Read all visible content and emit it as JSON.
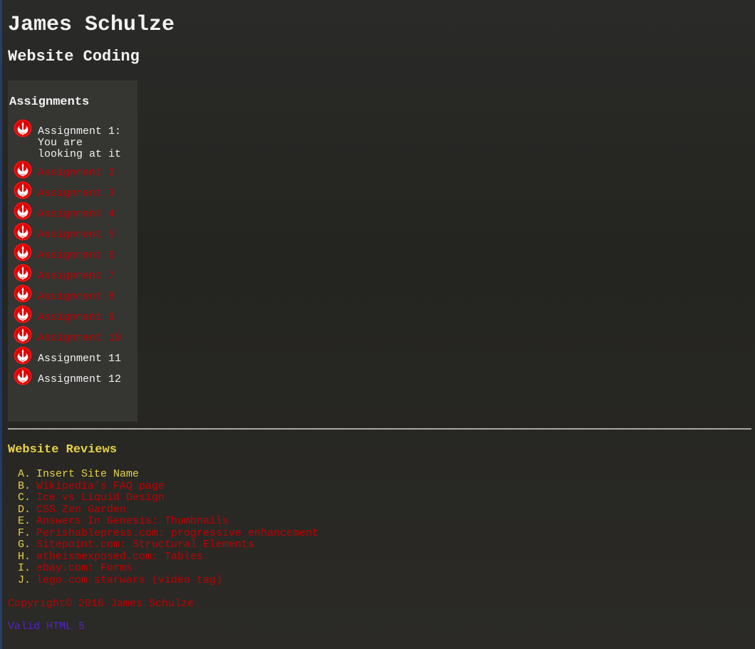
{
  "header": {
    "name": "James Schulze",
    "subtitle": "Website Coding"
  },
  "sidebar": {
    "title": "Assignments",
    "items": [
      {
        "label": "Assignment 1:\nYou are\nlooking at it",
        "link": false
      },
      {
        "label": "Assignment 2",
        "link": true
      },
      {
        "label": "Assignment 3",
        "link": true
      },
      {
        "label": "Assignment 4",
        "link": true
      },
      {
        "label": "Assignment 5",
        "link": true
      },
      {
        "label": "Assignment 6",
        "link": true
      },
      {
        "label": "Assignment 7",
        "link": true
      },
      {
        "label": "Assignment 8",
        "link": true
      },
      {
        "label": "Assignment 9",
        "link": true
      },
      {
        "label": "Assignment 10",
        "link": true
      },
      {
        "label": "Assignment 11",
        "link": false
      },
      {
        "label": "Assignment 12",
        "link": false
      }
    ]
  },
  "reviews": {
    "title": "Website Reviews",
    "items": [
      {
        "marker": "A.",
        "label": "Insert Site Name",
        "link": false
      },
      {
        "marker": "B.",
        "label": "Wikipedia's FAQ page",
        "link": true
      },
      {
        "marker": "C.",
        "label": "Ice vs Liquid Design",
        "link": true
      },
      {
        "marker": "D.",
        "label": "CSS Zen Garden",
        "link": true
      },
      {
        "marker": "E.",
        "label": "Answers In Genesis: Thumbnails",
        "link": true
      },
      {
        "marker": "F.",
        "label": "Perishablepress.com: progressive enhancement",
        "link": true
      },
      {
        "marker": "G.",
        "label": "Sitepoint.com: Structural Elements",
        "link": true
      },
      {
        "marker": "H.",
        "label": "atheismexposed.com: Tables",
        "link": true
      },
      {
        "marker": "I.",
        "label": "ebay.com: Forms",
        "link": true
      },
      {
        "marker": "J.",
        "label": "lego.com starwars (video tag)",
        "link": true
      }
    ]
  },
  "footer": {
    "copyright": "Copyright© 2016 James Schulze",
    "valid": "Valid HTML 5"
  },
  "colors": {
    "link": "#c40000",
    "heading_yellow": "#e8d24a",
    "valid_link": "#5522cc",
    "sidebar_bg": "#353531"
  },
  "icons": {
    "list_bullet": "rebel-alliance-icon"
  }
}
